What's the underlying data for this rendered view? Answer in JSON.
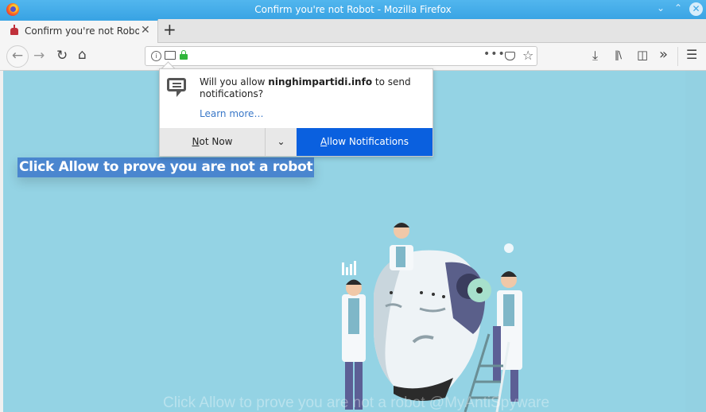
{
  "window": {
    "title": "Confirm you're not Robot - Mozilla Firefox",
    "controls": {
      "minimize": "⌄",
      "maximize": "⌃",
      "close": "✕"
    }
  },
  "tabs": [
    {
      "label": "Confirm you're not Robot",
      "close": "✕",
      "favicon": "robot-icon"
    }
  ],
  "newtab_label": "+",
  "nav": {
    "back": "←",
    "forward": "→",
    "reload": "↻",
    "home": "⌂",
    "url": "",
    "page_actions": "•••",
    "pocket": "pocket-icon",
    "bookmark": "☆",
    "download": "⤓",
    "library": "‖\\",
    "sidebar": "◫",
    "overflow": "»",
    "menu": "☰"
  },
  "notification_popup": {
    "msg_prefix": "Will you allow ",
    "site": "ninghimpartidi.info",
    "msg_suffix": " to send notifications?",
    "learn_more": "Learn more…",
    "not_now_accesskey": "N",
    "not_now_rest": "ot Now",
    "dropdown": "⌄",
    "allow_accesskey": "A",
    "allow_rest": "llow Notifications"
  },
  "page": {
    "headline": "Click Allow to prove you are not a robot",
    "watermark": "Click Allow to prove you are not a robot @MyAntiSpyware"
  },
  "colors": {
    "titlebar": "#3aa4e4",
    "page_bg": "#94d3e4",
    "allow_button": "#0a60df",
    "headline_bg": "#4a86cf",
    "link": "#3a78c8"
  }
}
